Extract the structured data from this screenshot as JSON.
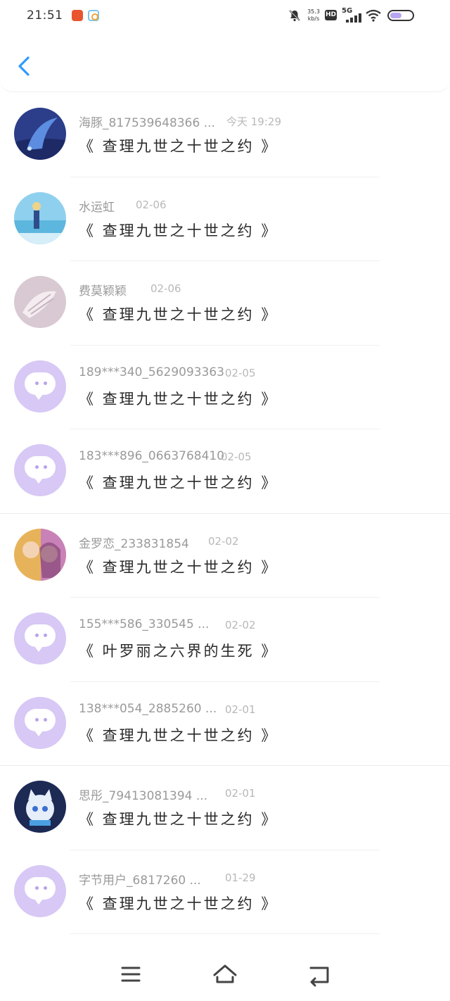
{
  "status_bar": {
    "time": "21:51",
    "net_speed_value": "35.3",
    "net_speed_unit": "kb/s",
    "hd_label": "HD",
    "network_label": "5G",
    "battery_level": 0.6,
    "battery_color": "#b9a6f3"
  },
  "header": {
    "back_icon": "chevron-left-icon",
    "accent_color": "#2f9bff"
  },
  "messages": [
    {
      "name": "海豚_817539648366 ...",
      "date": "今天 19:29",
      "text": "《 查理九世之十世之约 》",
      "avatar": "photo-ocean"
    },
    {
      "name": "水运虹",
      "date": "02-06",
      "text": "《 查理九世之十世之约 》",
      "avatar": "photo-beach"
    },
    {
      "name": "费莫颖颖",
      "date": "02-06",
      "text": "《 查理九世之十世之约 》",
      "avatar": "photo-shell"
    },
    {
      "name": "189***340_5629093363",
      "date": "02-05",
      "text": "《 查理九世之十世之约 》",
      "avatar": "default-chat"
    },
    {
      "name": "183***896_0663768410",
      "date": "02-05",
      "text": "《 查理九世之十世之约 》",
      "avatar": "default-chat"
    },
    {
      "name": "金罗恋_233831854",
      "date": "02-02",
      "text": "《 查理九世之十世之约 》",
      "avatar": "photo-anime"
    },
    {
      "name": "155***586_330545 ...",
      "date": "02-02",
      "text": "《 叶罗丽之六界的生死 》",
      "avatar": "default-chat"
    },
    {
      "name": "138***054_2885260 ...",
      "date": "02-01",
      "text": "《 查理九世之十世之约 》",
      "avatar": "default-chat"
    },
    {
      "name": "思彤_79413081394 ...",
      "date": "02-01",
      "text": "《 查理九世之十世之约 》",
      "avatar": "photo-cat"
    },
    {
      "name": "字节用户_6817260 ...",
      "date": "01-29",
      "text": "《 查理九世之十世之约 》",
      "avatar": "default-chat"
    }
  ],
  "nav_bar": {
    "menu_icon": "menu-icon",
    "home_icon": "home-icon",
    "back_icon": "back-icon"
  }
}
